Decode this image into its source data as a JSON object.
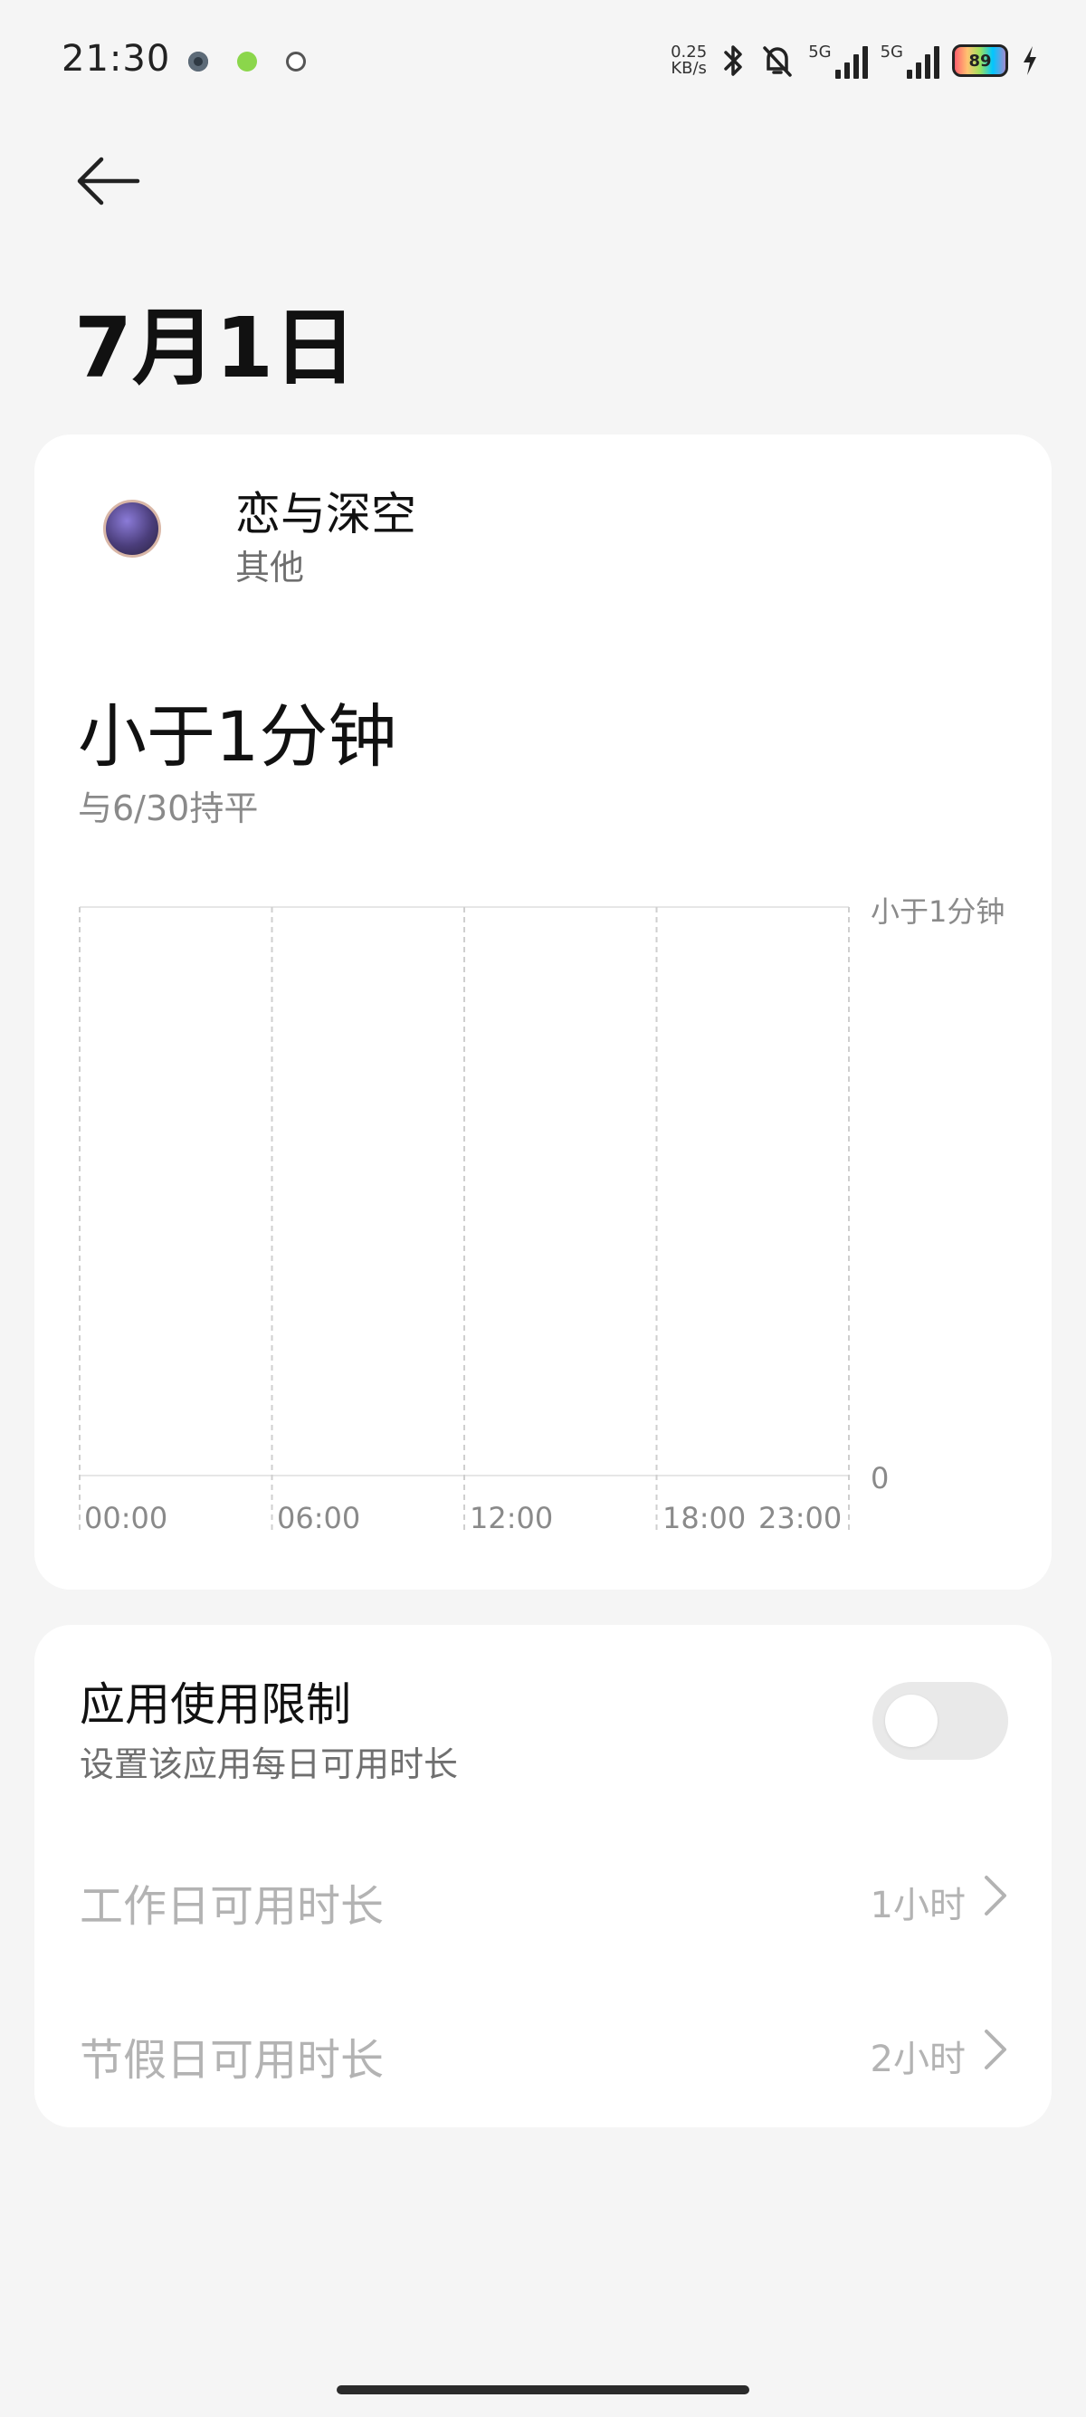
{
  "status_bar": {
    "time": "21:30",
    "net_speed_value": "0.25",
    "net_speed_unit": "KB/s",
    "network_label_1": "5G",
    "network_label_2": "5G",
    "battery_level": "89",
    "icons": [
      "notification-dot-icon",
      "app-notification-icon",
      "sync-icon",
      "bluetooth-icon",
      "mute-icon",
      "signal-icon",
      "charging-icon"
    ]
  },
  "header": {
    "title": "7月1日",
    "back_icon": "arrow-left-icon"
  },
  "app_info": {
    "name": "恋与深空",
    "category": "其他",
    "usage": "小于1分钟",
    "comparison": "与6/30持平"
  },
  "chart_data": {
    "type": "bar",
    "categories": [
      "00:00",
      "06:00",
      "12:00",
      "18:00",
      "23:00"
    ],
    "values": [
      0,
      0,
      0,
      0,
      0
    ],
    "y_labels": [
      "小于1分钟",
      "0"
    ],
    "grid": true
  },
  "limits": {
    "title": "应用使用限制",
    "subtitle": "设置该应用每日可用时长",
    "enabled": false,
    "rows": [
      {
        "label": "工作日可用时长",
        "value": "1小时"
      },
      {
        "label": "节假日可用时长",
        "value": "2小时"
      }
    ]
  },
  "colors": {
    "background": "#f5f5f5",
    "card": "#ffffff",
    "disabled_text": "#b3b3b3",
    "secondary_text": "#8a8a8a"
  }
}
